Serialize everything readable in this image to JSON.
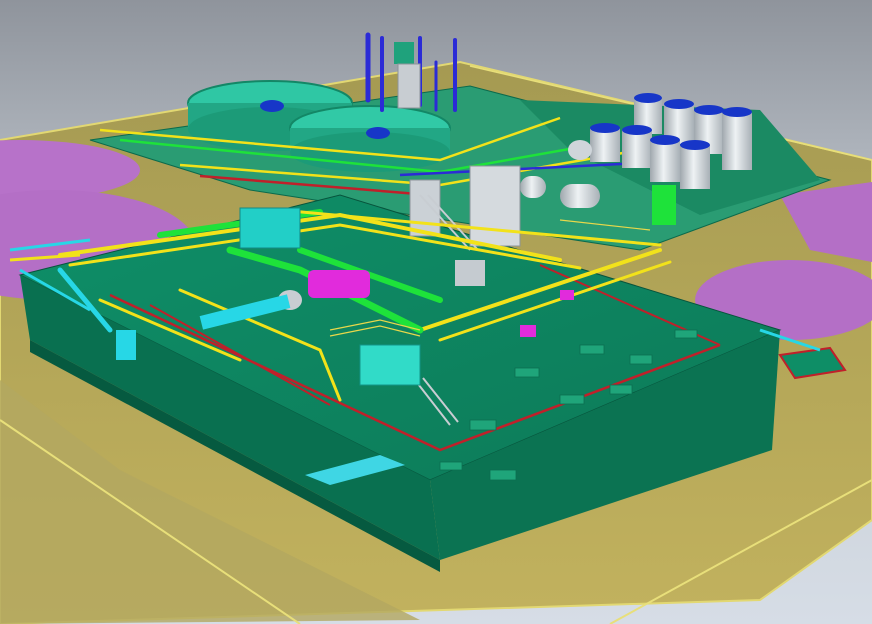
{
  "viewport": {
    "content": "3d-plant-model",
    "colors": {
      "sky_top": "#8f949c",
      "sky_bottom": "#d6dde6",
      "ground": "#b5a555",
      "ground_edge": "#e2d872",
      "platform": "#0e8e66",
      "platform_side": "#0a6e50",
      "pond": "#b672c8",
      "pipe_yellow": "#f2e21a",
      "pipe_green": "#1ee23a",
      "pipe_cyan": "#27d7e6",
      "pipe_magenta": "#e12bdc",
      "structure_red": "#c0202a",
      "vessel": "#d7dde2",
      "tank_blue": "#1736c8",
      "column_blue": "#2b2bd6"
    }
  }
}
